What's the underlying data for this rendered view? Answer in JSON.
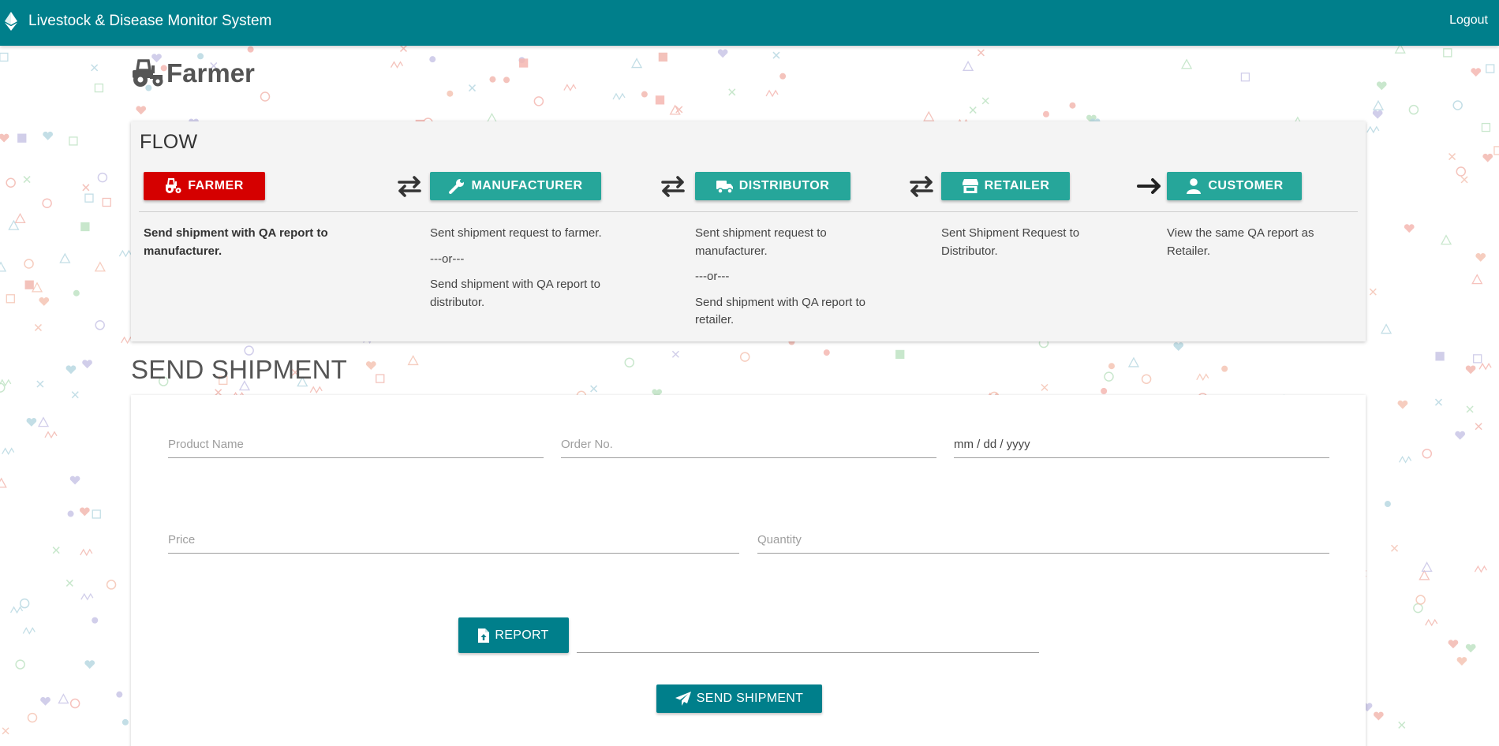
{
  "header": {
    "brand_icon": "ethereum-icon",
    "title": "Livestock & Disease Monitor System",
    "logout_label": "Logout"
  },
  "page": {
    "icon": "tractor-icon",
    "title": "Farmer"
  },
  "flow": {
    "heading": "FLOW",
    "steps": [
      {
        "label": "FARMER",
        "icon": "tractor-icon",
        "active": true,
        "lines": [
          "Send shipment with QA report to manufacturer."
        ]
      },
      {
        "label": "MANUFACTURER",
        "icon": "wrench-icon",
        "active": false,
        "lines": [
          "Sent shipment request to farmer.",
          "---or---",
          "Send shipment with QA report to distributor."
        ]
      },
      {
        "label": "DISTRIBUTOR",
        "icon": "truck-icon",
        "active": false,
        "lines": [
          "Sent shipment request to manufacturer.",
          "---or---",
          "Send shipment with QA report to retailer."
        ]
      },
      {
        "label": "RETAILER",
        "icon": "store-icon",
        "active": false,
        "lines": [
          "Sent Shipment Request to Distributor."
        ]
      },
      {
        "label": "CUSTOMER",
        "icon": "user-icon",
        "active": false,
        "lines": [
          "View the same QA report as Retailer."
        ]
      }
    ],
    "arrows": [
      "exchange-arrows-icon",
      "exchange-arrows-icon",
      "exchange-arrows-icon",
      "right-arrow-icon"
    ]
  },
  "send_shipment": {
    "title": "SEND SHIPMENT",
    "product_name_placeholder": "Product Name",
    "product_name_value": "",
    "order_no_placeholder": "Order No.",
    "order_no_value": "",
    "date_placeholder": "mm / dd / yyyy",
    "price_placeholder": "Price",
    "price_value": "",
    "quantity_placeholder": "Quantity",
    "quantity_value": "",
    "report_button_label": "REPORT",
    "report_file_value": "",
    "submit_button_label": "SEND SHIPMENT"
  },
  "colors": {
    "navbar": "#007f8b",
    "accent_teal": "#26a69a",
    "active_red": "#d50000",
    "card_bg": "#f4f4f4"
  }
}
